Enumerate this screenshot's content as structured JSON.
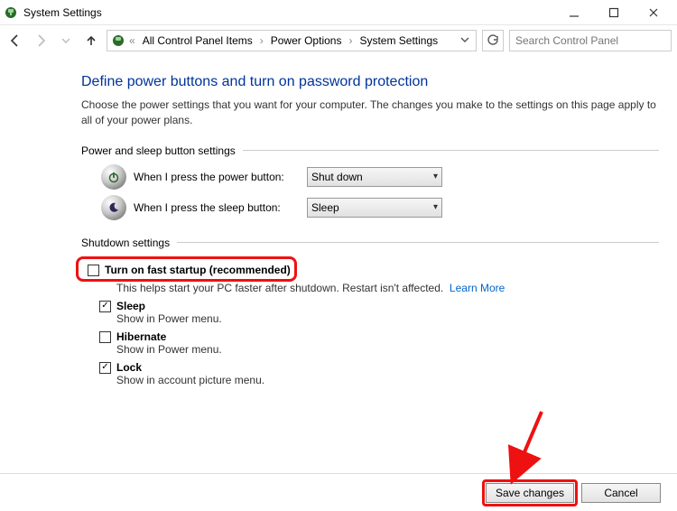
{
  "window": {
    "title": "System Settings"
  },
  "nav": {
    "crumbs": [
      "All Control Panel Items",
      "Power Options",
      "System Settings"
    ],
    "search_placeholder": "Search Control Panel"
  },
  "page": {
    "heading": "Define power buttons and turn on password protection",
    "description": "Choose the power settings that you want for your computer. The changes you make to the settings on this page apply to all of your power plans.",
    "section_power_sleep": "Power and sleep button settings",
    "power_button": {
      "label": "When I press the power button:",
      "value": "Shut down"
    },
    "sleep_button": {
      "label": "When I press the sleep button:",
      "value": "Sleep"
    },
    "section_shutdown": "Shutdown settings",
    "fast_startup": {
      "label": "Turn on fast startup (recommended)",
      "desc": "This helps start your PC faster after shutdown. Restart isn't affected.",
      "link": "Learn More",
      "checked": false
    },
    "sleep": {
      "label": "Sleep",
      "desc": "Show in Power menu.",
      "checked": true
    },
    "hibernate": {
      "label": "Hibernate",
      "desc": "Show in Power menu.",
      "checked": false
    },
    "lock": {
      "label": "Lock",
      "desc": "Show in account picture menu.",
      "checked": true
    }
  },
  "buttons": {
    "save": "Save changes",
    "cancel": "Cancel"
  }
}
